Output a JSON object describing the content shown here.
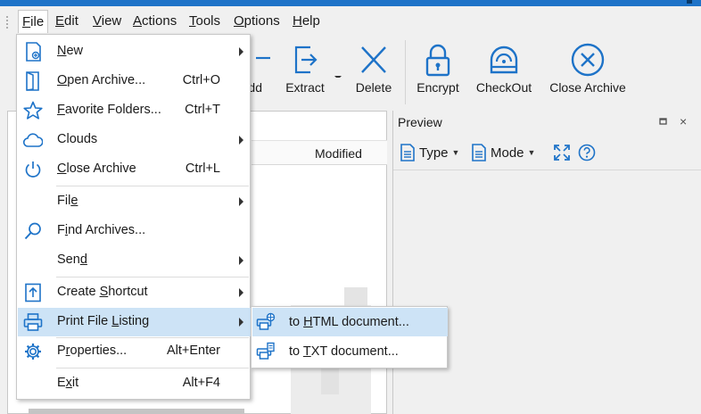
{
  "menubar": {
    "items": [
      {
        "pre": "",
        "key": "F",
        "post": "ile"
      },
      {
        "pre": "",
        "key": "E",
        "post": "dit"
      },
      {
        "pre": "",
        "key": "V",
        "post": "iew"
      },
      {
        "pre": "",
        "key": "A",
        "post": "ctions"
      },
      {
        "pre": "",
        "key": "T",
        "post": "ools"
      },
      {
        "pre": "",
        "key": "O",
        "post": "ptions"
      },
      {
        "pre": "",
        "key": "H",
        "post": "elp"
      }
    ]
  },
  "ribbon": {
    "partial_label": "dd",
    "extract": "Extract",
    "delete": "Delete",
    "encrypt": "Encrypt",
    "checkout": "CheckOut",
    "close_archive": "Close Archive"
  },
  "file_list": {
    "column_modified": "Modified"
  },
  "preview": {
    "title": "Preview",
    "close_glyph": "×",
    "type_label": "Type",
    "mode_label": "Mode"
  },
  "file_menu": {
    "new": {
      "pre": "",
      "key": "N",
      "post": "ew"
    },
    "open_archive": {
      "pre": "",
      "key": "O",
      "post": "pen Archive...",
      "shortcut": "Ctrl+O"
    },
    "favorite_folders": {
      "pre": "",
      "key": "F",
      "post": "avorite Folders...",
      "shortcut": "Ctrl+T"
    },
    "clouds": {
      "label": "Clouds"
    },
    "close_archive": {
      "pre": "",
      "key": "C",
      "post": "lose Archive",
      "shortcut": "Ctrl+L"
    },
    "file": {
      "pre": "Fil",
      "key": "e",
      "post": ""
    },
    "find_archives": {
      "pre": "F",
      "key": "i",
      "post": "nd Archives..."
    },
    "send": {
      "pre": "Sen",
      "key": "d",
      "post": ""
    },
    "create_shortcut": {
      "pre": "Create ",
      "key": "S",
      "post": "hortcut"
    },
    "print_file_listing": {
      "pre": "Print File ",
      "key": "L",
      "post": "isting"
    },
    "properties": {
      "pre": "P",
      "key": "r",
      "post": "operties...",
      "shortcut": "Alt+Enter"
    },
    "exit": {
      "pre": "E",
      "key": "x",
      "post": "it",
      "shortcut": "Alt+F4"
    }
  },
  "print_submenu": {
    "html": {
      "pre": "to ",
      "key": "H",
      "post": "TML document..."
    },
    "txt": {
      "pre": "to ",
      "key": "T",
      "post": "XT document..."
    }
  },
  "colors": {
    "accent": "#1e73c8",
    "highlight": "#cde3f6",
    "icon_blue": "#1e73c8"
  }
}
